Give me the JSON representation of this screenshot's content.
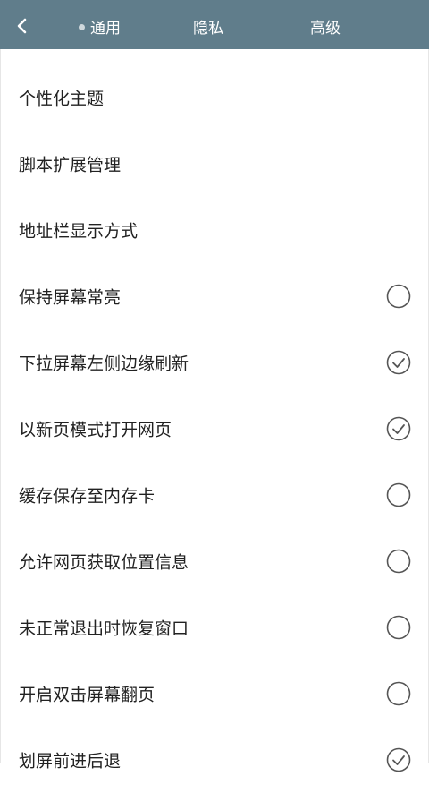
{
  "header": {
    "tabs": [
      {
        "label": "通用",
        "active": true
      },
      {
        "label": "隐私",
        "active": false
      },
      {
        "label": "高级",
        "active": false
      }
    ],
    "back_icon": "chevron-left-icon"
  },
  "settings": [
    {
      "label": "个性化主题"
    },
    {
      "label": "脚本扩展管理"
    },
    {
      "label": "地址栏显示方式"
    },
    {
      "label": "保持屏幕常亮",
      "checked": false
    },
    {
      "label": "下拉屏幕左侧边缘刷新",
      "checked": true
    },
    {
      "label": "以新页模式打开网页",
      "checked": true
    },
    {
      "label": "缓存保存至内存卡",
      "checked": false
    },
    {
      "label": "允许网页获取位置信息",
      "checked": false
    },
    {
      "label": "未正常退出时恢复窗口",
      "checked": false
    },
    {
      "label": "开启双击屏幕翻页",
      "checked": false
    },
    {
      "label": "划屏前进后退",
      "checked": true
    }
  ],
  "colors": {
    "header_bg": "#607d8b",
    "header_text": "#ffffff",
    "check_stroke": "#555555"
  }
}
